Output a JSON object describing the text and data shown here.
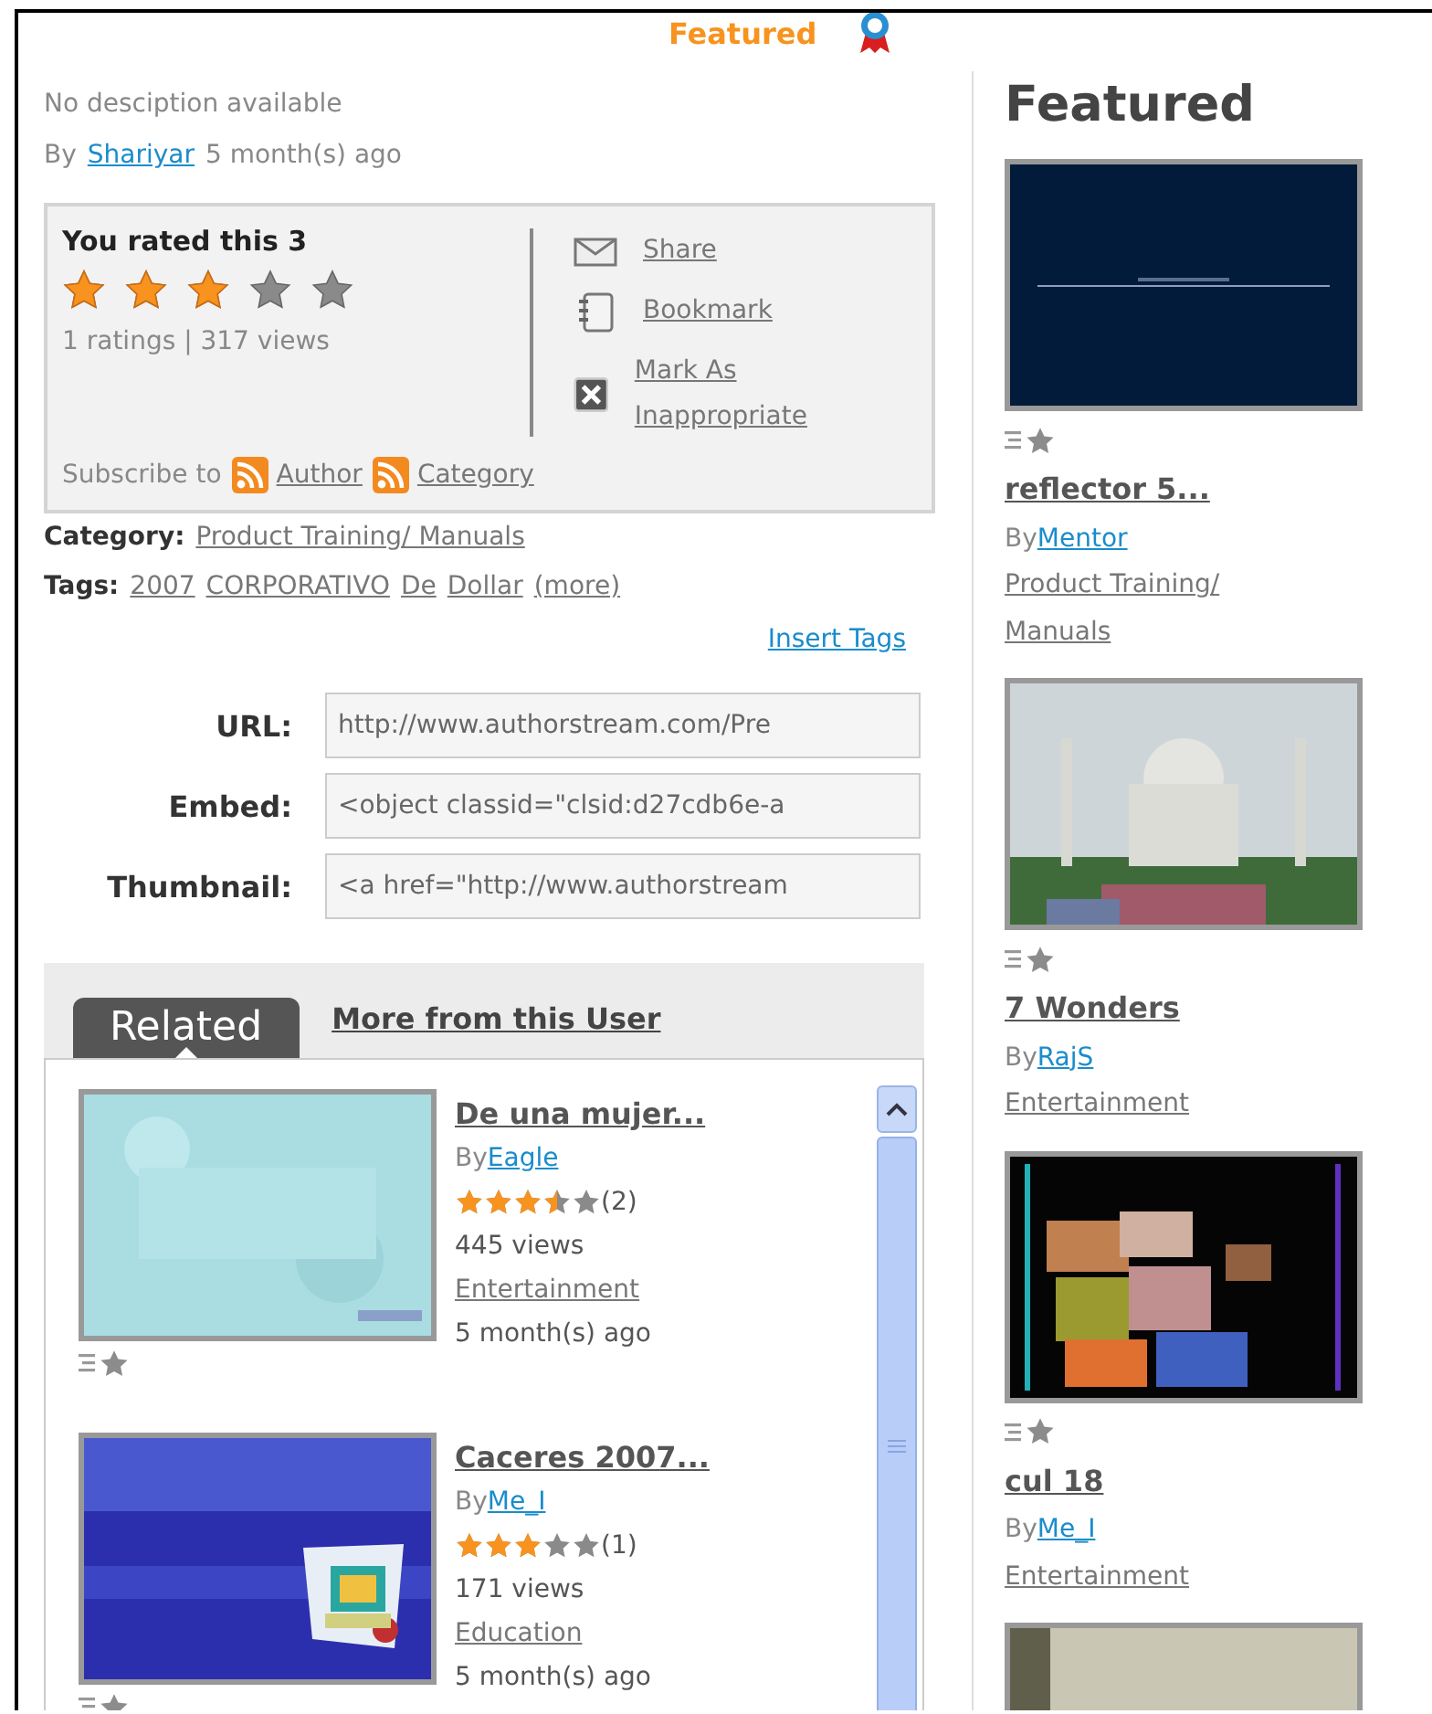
{
  "header": {
    "title": "Featured"
  },
  "description": "No desciption available",
  "byline": {
    "prefix": "By",
    "author": "Shariyar",
    "time": "5 month(s) ago"
  },
  "rating": {
    "title": "You rated this 3",
    "stars": 3,
    "stats": "1 ratings | 317 views"
  },
  "actions": [
    {
      "kind": "share",
      "label": "Share"
    },
    {
      "kind": "bookmark",
      "label": "Bookmark"
    },
    {
      "kind": "flag",
      "label": "Mark As Inappropriate"
    }
  ],
  "subscribe": {
    "label": "Subscribe to",
    "links": [
      "Author",
      "Category"
    ]
  },
  "category": {
    "label": "Category:",
    "value": "Product Training/ Manuals"
  },
  "tags": {
    "label": "Tags:",
    "items": [
      "2007",
      "CORPORATIVO",
      "De",
      "Dollar"
    ],
    "more": "(more)"
  },
  "insert_tags": "Insert Tags",
  "share_fields": [
    {
      "label": "URL:",
      "value": "http://www.authorstream.com/Pre"
    },
    {
      "label": "Embed:",
      "value": "<object classid=\"clsid:d27cdb6e-a"
    },
    {
      "label": "Thumbnail:",
      "value": "<a href=\"http://www.authorstream"
    }
  ],
  "tabs": [
    {
      "label": "Related",
      "selected": true
    },
    {
      "label": "More from this User",
      "selected": false
    }
  ],
  "related": [
    {
      "title": "De una mujer...",
      "by": "By",
      "author": "Eagle",
      "stars": 3.5,
      "count": "(2)",
      "views": "445 views",
      "category": "Entertainment",
      "time": "5 month(s) ago"
    },
    {
      "title": "Caceres 2007...",
      "by": "By",
      "author": "Me_I",
      "stars": 3,
      "count": "(1)",
      "views": "171 views",
      "category": "Education",
      "time": "5 month(s) ago"
    }
  ],
  "featured": {
    "heading": "Featured",
    "items": [
      {
        "kind": "entry",
        "title": "reflector 5...",
        "by": "By",
        "author": "Mentor",
        "category": "Product Training/ Manuals"
      },
      {
        "kind": "entry",
        "title": "7 Wonders",
        "by": "By",
        "author": "RajS",
        "category": "Entertainment"
      },
      {
        "kind": "entry",
        "title": "cul 18",
        "by": "By",
        "author": "Me_I",
        "category": "Entertainment"
      },
      {
        "kind": "picture"
      }
    ]
  }
}
